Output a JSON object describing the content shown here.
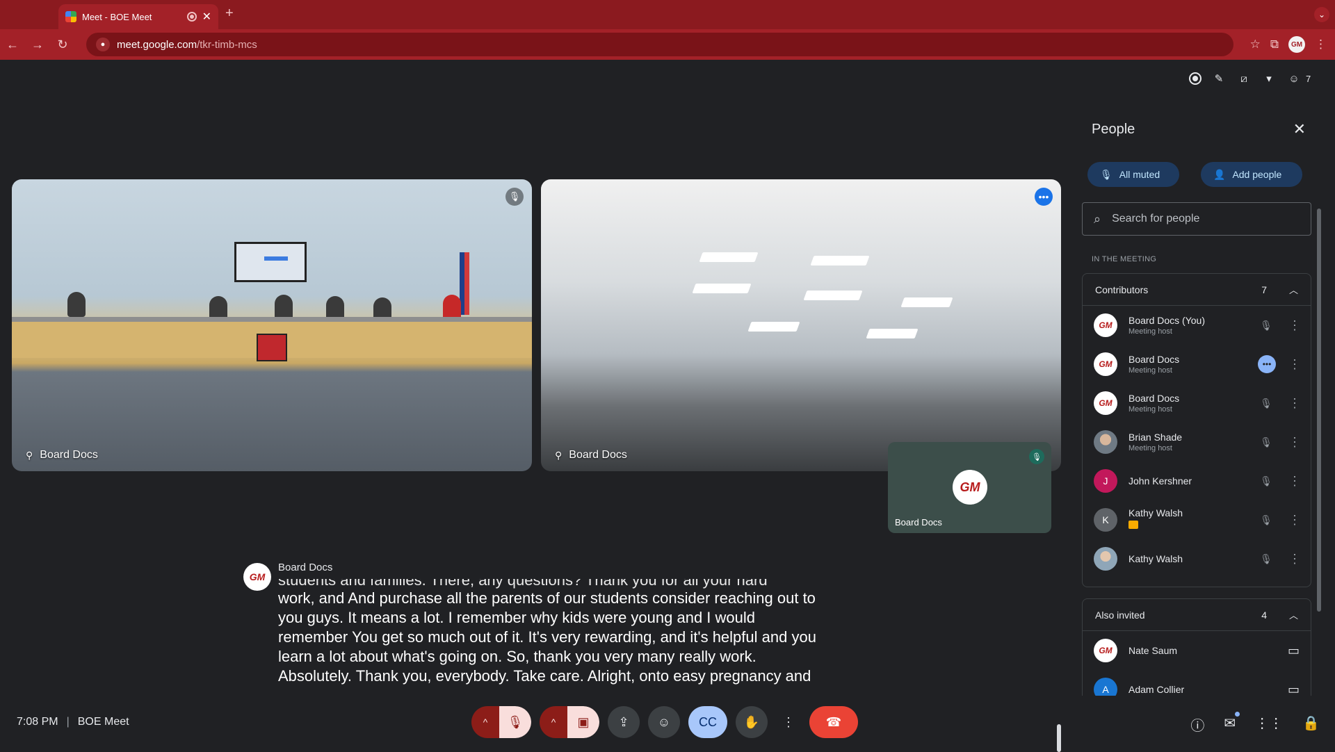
{
  "browser": {
    "tab_title": "Meet - BOE Meet",
    "url_host": "meet.google.com",
    "url_path": "/tkr-timb-mcs"
  },
  "meet": {
    "people_count": "7",
    "tiles": [
      {
        "name": "Board Docs"
      },
      {
        "name": "Board Docs"
      }
    ],
    "self_tile": {
      "name": "Board Docs",
      "avatar_text": "GM"
    },
    "caption": {
      "speaker": "Board Docs",
      "faded_line": "students and families. There, any questions? Thank you for all your hard",
      "text": "work, and And purchase all the parents of our students consider reaching out to you guys. It means a lot. I remember why kids were young and I would remember You get so much out of it. It's very rewarding, and it's helpful and you learn a lot about what's going on. So, thank you very many really work. Absolutely. Thank you, everybody. Take care. Alright, onto easy pregnancy and"
    },
    "panel": {
      "title": "People",
      "all_muted_label": "All muted",
      "add_people_label": "Add people",
      "search_placeholder": "Search for people",
      "section_label": "IN THE MEETING",
      "contributors_label": "Contributors",
      "contributors_count": "7",
      "contributors": [
        {
          "name": "Board Docs (You)",
          "role": "Meeting host",
          "avatar": "GM"
        },
        {
          "name": "Board Docs",
          "role": "Meeting host",
          "avatar": "GM"
        },
        {
          "name": "Board Docs",
          "role": "Meeting host",
          "avatar": "GM"
        },
        {
          "name": "Brian Shade",
          "role": "Meeting host",
          "avatar": ""
        },
        {
          "name": "John Kershner",
          "role": "",
          "avatar": "J"
        },
        {
          "name": "Kathy Walsh",
          "role": "",
          "avatar": "K"
        },
        {
          "name": "Kathy Walsh",
          "role": "",
          "avatar": ""
        }
      ],
      "invited_label": "Also invited",
      "invited_count": "4",
      "invited": [
        {
          "name": "Nate Saum",
          "avatar": "GM"
        },
        {
          "name": "Adam Collier",
          "avatar": "A"
        }
      ]
    },
    "bottom": {
      "time": "7:08 PM",
      "meeting_name": "BOE Meet"
    }
  }
}
